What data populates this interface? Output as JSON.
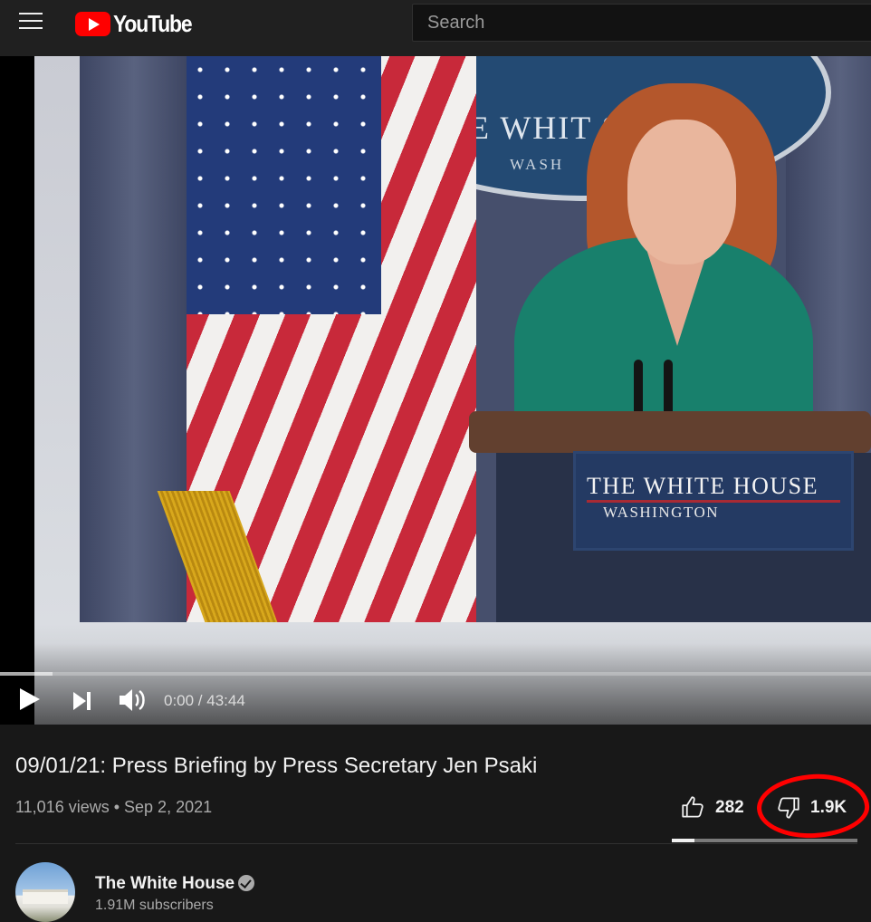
{
  "header": {
    "logo_text": "YouTube",
    "search_placeholder": "Search"
  },
  "player": {
    "time": "0:00 / 43:44",
    "progress_fraction": 0.06,
    "scene_text": {
      "seal_line1": "THE WHIT    SE",
      "seal_line2": "WASH",
      "podium_line1": "THE WHITE HOUSE",
      "podium_line2": "WASHINGTON"
    }
  },
  "video": {
    "title": "09/01/21: Press Briefing by Press Secretary Jen Psaki",
    "meta": "11,016 views • Sep 2, 2021",
    "likes": "282",
    "dislikes": "1.9K",
    "like_ratio": 0.12
  },
  "channel": {
    "name": "The White House",
    "subscribers": "1.91M subscribers"
  },
  "colors": {
    "brand_red": "#ff0000",
    "background": "#181818",
    "annotation": "#ff0000"
  },
  "icons": [
    "menu-icon",
    "youtube-logo-icon",
    "play-icon",
    "next-icon",
    "volume-icon",
    "thumbs-up-icon",
    "thumbs-down-icon",
    "verified-icon"
  ]
}
